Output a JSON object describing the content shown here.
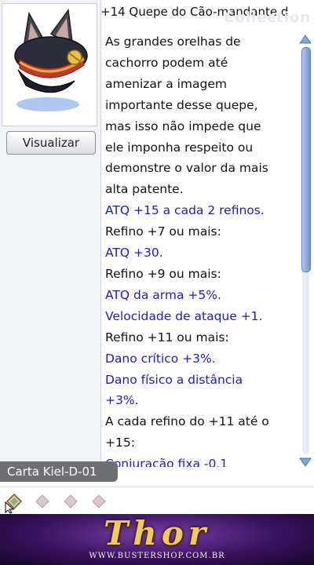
{
  "window": {
    "title": "+14 Quepe do Cão-mandante d",
    "watermark": "Collection",
    "preview_button": "Visualizar",
    "card_label": "Carta Kiel-D-01"
  },
  "description": [
    {
      "text": "As grandes orelhas de",
      "color": "black"
    },
    {
      "text": "cachorro podem até",
      "color": "black"
    },
    {
      "text": "amenizar a imagem",
      "color": "black"
    },
    {
      "text": "importante desse quepe,",
      "color": "black"
    },
    {
      "text": "mas isso não impede que",
      "color": "black"
    },
    {
      "text": "ele imponha respeito ou",
      "color": "black"
    },
    {
      "text": "demonstre o valor da mais",
      "color": "black"
    },
    {
      "text": "alta patente.",
      "color": "black"
    },
    {
      "text": "ATQ +15 a cada 2 refinos.",
      "color": "blue"
    },
    {
      "text": "Refino +7 ou mais:",
      "color": "black"
    },
    {
      "text": "ATQ +30.",
      "color": "blue"
    },
    {
      "text": "Refino +9 ou mais:",
      "color": "black"
    },
    {
      "text": "ATQ da arma +5%.",
      "color": "blue"
    },
    {
      "text": "Velocidade de ataque +1.",
      "color": "blue"
    },
    {
      "text": "Refino +11 ou mais:",
      "color": "black"
    },
    {
      "text": "Dano crítico +3%.",
      "color": "blue"
    },
    {
      "text": "Dano físico a distância",
      "color": "blue"
    },
    {
      "text": "+3%.",
      "color": "blue"
    },
    {
      "text": "A cada refino do +11 até o",
      "color": "black"
    },
    {
      "text": "+15:",
      "color": "black"
    },
    {
      "text": "Conjuração fixa -0,1",
      "color": "blue"
    }
  ],
  "scroll": {
    "position": 0.0,
    "visible_fraction": 0.55
  },
  "slots": {
    "count": 4,
    "filled": 1
  },
  "banner": {
    "title": "Thor",
    "url": "WWW.BUSTERSHOP.COM.BR"
  },
  "colors": {
    "text_black": "#111111",
    "text_blue": "#1a1ad0",
    "card_label_bg": "#6e6f73",
    "banner_bg": "#3a1260",
    "banner_gold": "#f3c95a"
  },
  "icons": [
    "dog-ear-cap-icon",
    "scroll-up-icon",
    "scroll-down-icon",
    "card-slot-icon",
    "mouse-cursor-icon"
  ]
}
